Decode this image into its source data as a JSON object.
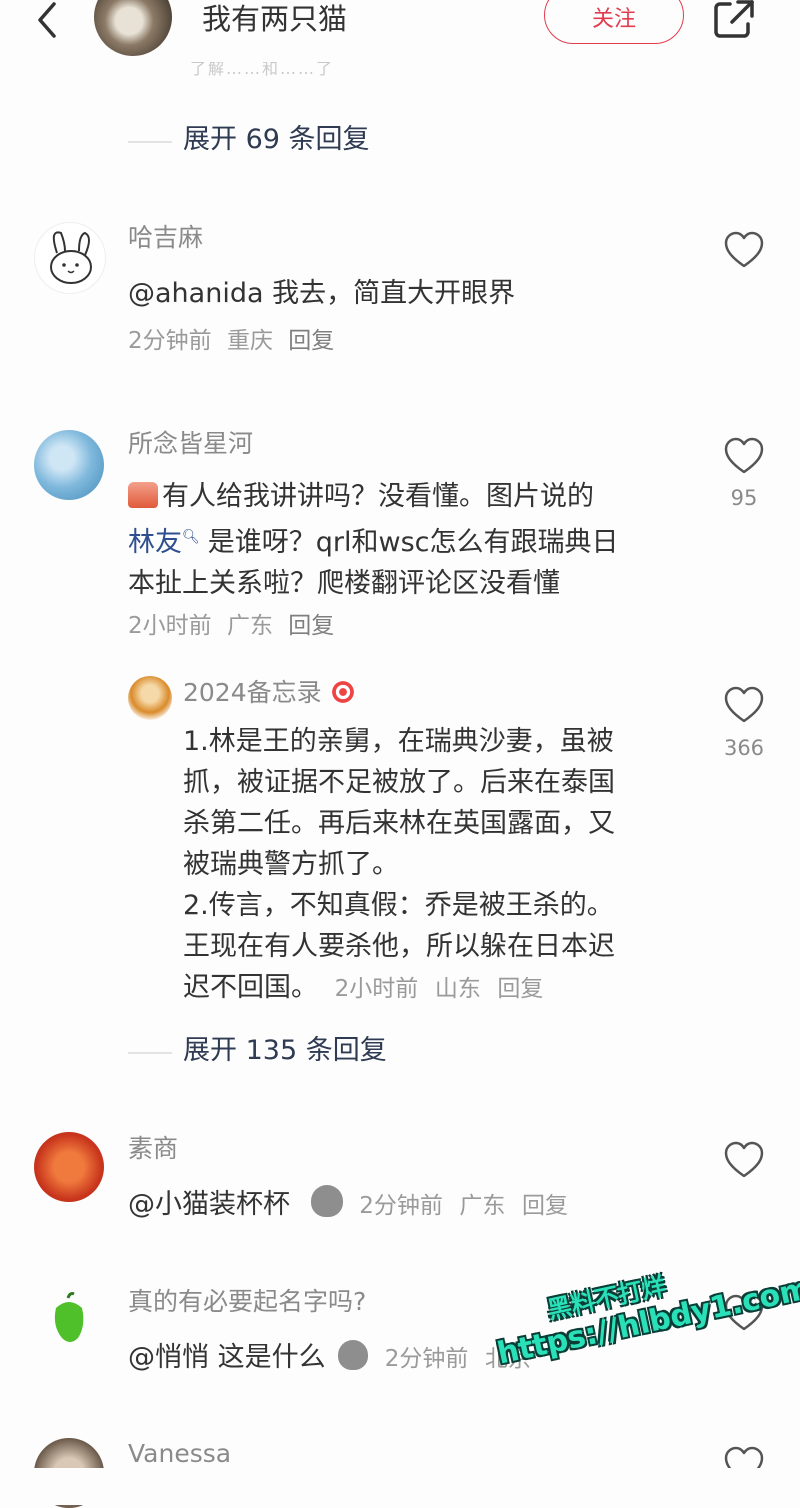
{
  "header": {
    "back_icon": "chevron-left-icon",
    "title": "我有两只猫",
    "follow_label": "关注",
    "share_icon": "share-icon"
  },
  "top_ghost_text": "了解……和……了",
  "expand_top": "展开 69 条回复",
  "comments": [
    {
      "username": "哈吉麻",
      "text": "@ahanida 我去，简直大开眼界",
      "time": "2分钟前",
      "location": "重庆",
      "reply": "回复",
      "likes": ""
    },
    {
      "username": "所念皆星河",
      "text_lines": [
        "有人给我讲讲吗？没看懂。图片说的",
        "是谁呀？qrl和wsc怎么有跟瑞典日",
        "本扯上关系啦？爬楼翻评论区没看懂"
      ],
      "link_text": "林友",
      "time": "2小时前",
      "location": "广东",
      "reply": "回复",
      "likes": "95"
    },
    {
      "username": "2024备忘录",
      "text_lines": [
        "1.林是王的亲舅，在瑞典沙妻，虽被",
        "抓，被证据不足被放了。后来在泰国",
        "杀第二任。再后来林在英国露面，又",
        "被瑞典警方抓了。",
        "2.传言，不知真假：乔是被王杀的。",
        "王现在有人要杀他，所以躲在日本迟",
        "迟不回国。"
      ],
      "time": "2小时前",
      "location": "山东",
      "reply": "回复",
      "likes": "366"
    },
    {
      "username": "素商",
      "text": "@小猫装杯杯",
      "time": "2分钟前",
      "location": "广东",
      "reply": "回复"
    },
    {
      "username": "真的有必要起名字吗?",
      "text": "@悄悄 这是什么",
      "time": "2分钟前",
      "location": "北京"
    },
    {
      "username": "Vanessa"
    }
  ],
  "expand_mid": "展开 135 条回复",
  "watermark": {
    "line1": "黑料不打烊",
    "line2": "https://hlbdy1.com"
  },
  "colors": {
    "accent": "#e23d4e",
    "expand_text": "#2f3b52",
    "watermark": "#29e0b8"
  }
}
